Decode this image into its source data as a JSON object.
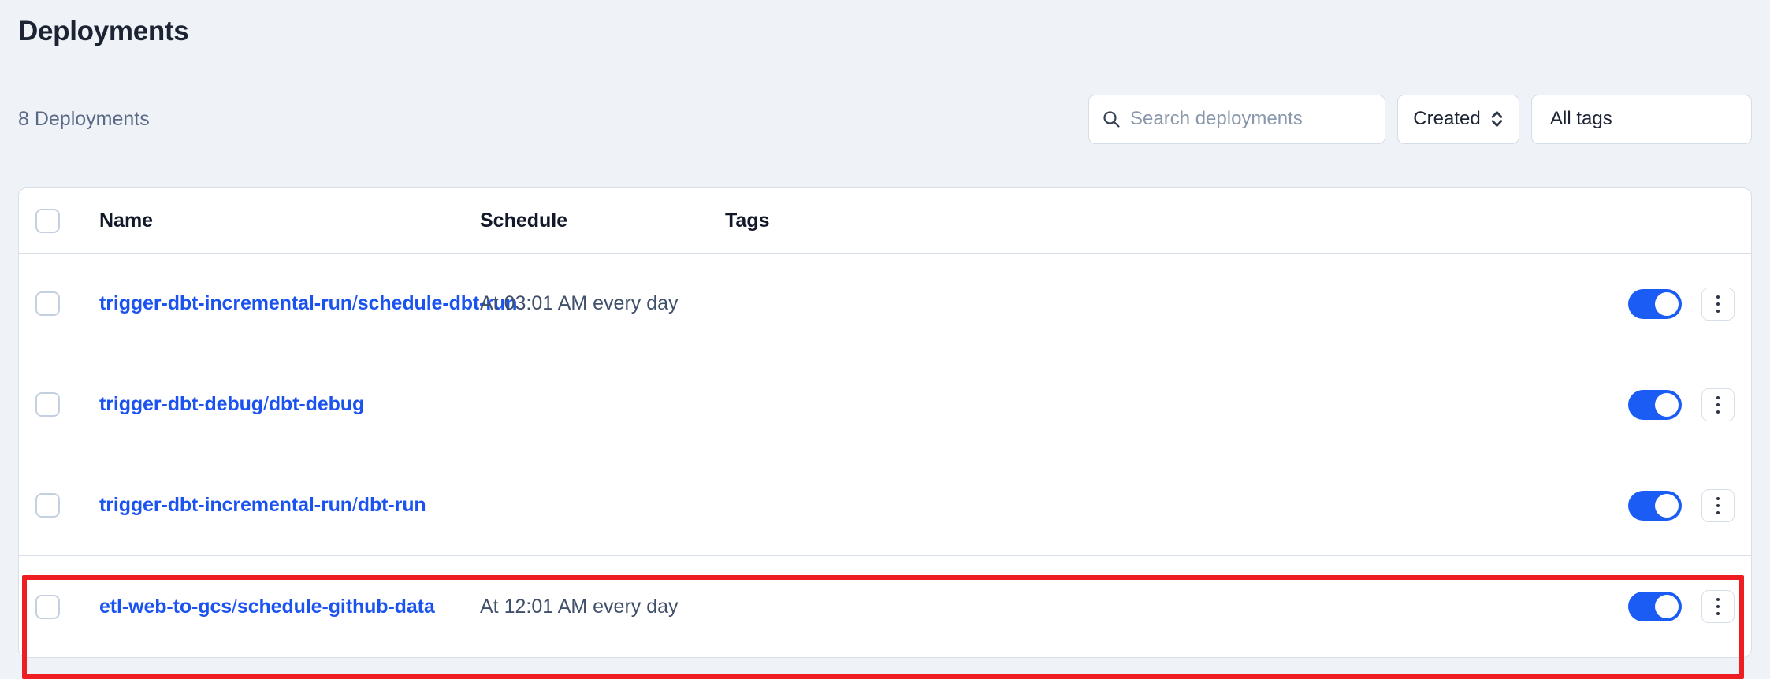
{
  "page": {
    "title": "Deployments",
    "background_color": "#eff3f8"
  },
  "toolbar": {
    "count_label": "8 Deployments",
    "search": {
      "placeholder": "Search deployments",
      "value": "",
      "icon": "search-icon"
    },
    "sort": {
      "label": "Created",
      "icon": "up-down-chevron-icon"
    },
    "tags_filter": {
      "label": "All tags"
    }
  },
  "table": {
    "columns": [
      "Name",
      "Schedule",
      "Tags"
    ],
    "select_all_checked": false,
    "rows": [
      {
        "checked": false,
        "name_prefix": "trigger-dbt-incremental-run",
        "name_separator": "/",
        "name_suffix": "schedule-dbt-run",
        "schedule": "At 03:01 AM every day",
        "tags": "",
        "enabled": true,
        "highlighted": false
      },
      {
        "checked": false,
        "name_prefix": "trigger-dbt-debug",
        "name_separator": "/",
        "name_suffix": "dbt-debug",
        "schedule": "",
        "tags": "",
        "enabled": true,
        "highlighted": false
      },
      {
        "checked": false,
        "name_prefix": "trigger-dbt-incremental-run",
        "name_separator": "/",
        "name_suffix": "dbt-run",
        "schedule": "",
        "tags": "",
        "enabled": true,
        "highlighted": false
      },
      {
        "checked": false,
        "name_prefix": "etl-web-to-gcs",
        "name_separator": "/",
        "name_suffix": "schedule-github-data",
        "schedule": "At 12:01 AM every day",
        "tags": "",
        "enabled": true,
        "highlighted": true
      }
    ]
  },
  "colors": {
    "link": "#1b53f0",
    "toggle_on": "#1b5cf5",
    "annotation": "#ee1d22",
    "text_primary": "#12182a",
    "text_muted": "#5a6a85",
    "border": "#d8dfe8"
  }
}
